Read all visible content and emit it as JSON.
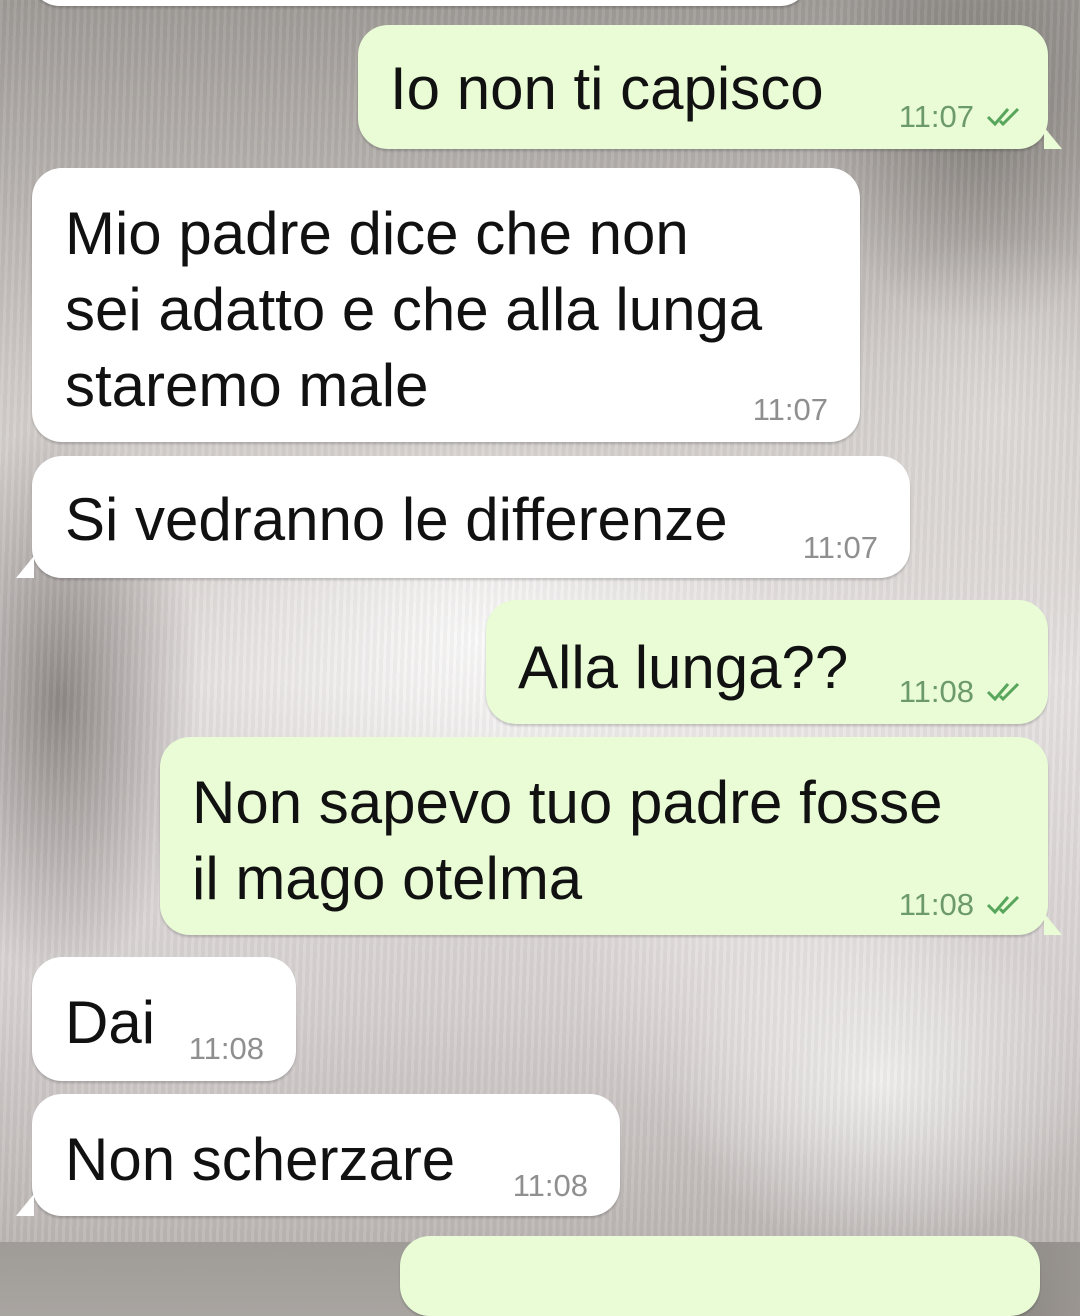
{
  "messages": [
    {
      "direction": "out",
      "text": "Io non ti capisco",
      "time": "11:07",
      "ticks": "double-check-icon"
    },
    {
      "direction": "in",
      "text": "Mio padre dice che non\nsei adatto e che alla lunga\nstaremo male",
      "time": "11:07"
    },
    {
      "direction": "in",
      "text": "Si vedranno le differenze",
      "time": "11:07"
    },
    {
      "direction": "out",
      "text": "Alla lunga??",
      "time": "11:08",
      "ticks": "double-check-icon"
    },
    {
      "direction": "out",
      "text": "Non sapevo tuo padre fosse\nil mago otelma",
      "time": "11:08",
      "ticks": "double-check-icon"
    },
    {
      "direction": "in",
      "text": "Dai",
      "time": "11:08"
    },
    {
      "direction": "in",
      "text": "Non scherzare",
      "time": "11:08"
    }
  ],
  "colors": {
    "incoming_bubble": "#ffffff",
    "outgoing_bubble": "#e9fcd6",
    "read_ticks": "#58a55c"
  }
}
